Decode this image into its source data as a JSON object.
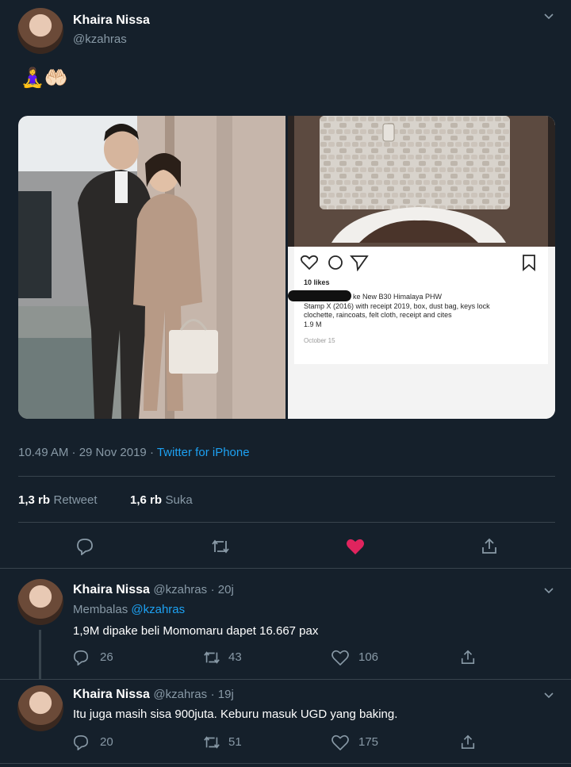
{
  "tweet": {
    "author_name": "Khaira Nissa",
    "author_handle": "@kzahras",
    "text": "🧘‍♀️🤲🏻",
    "timestamp": "10.49 AM · 29 Nov 2019 · ",
    "source": "Twitter for iPhone",
    "retweet_count": "1,3 rb",
    "retweet_label": "Retweet",
    "like_count": "1,6 rb",
    "like_label": "Suka",
    "embedded_image": {
      "likes": "10 likes",
      "caption_line1": "ke New B30 Himalaya PHW",
      "caption_line2": "Stamp X (2016) with receipt 2019, box, dust bag, keys lock",
      "caption_line3": "clochette, raincoats, felt cloth, receipt and cites",
      "caption_line4": "1.9 M",
      "date": "October 15"
    }
  },
  "replies": [
    {
      "author_name": "Khaira Nissa",
      "author_handle": "@kzahras",
      "time": "· 20j",
      "replying_label": "Membalas",
      "replying_to": "@kzahras",
      "text": "1,9M dipake beli Momomaru dapet 16.667 pax",
      "reply_count": "26",
      "retweet_count": "43",
      "like_count": "106"
    },
    {
      "author_name": "Khaira Nissa",
      "author_handle": "@kzahras",
      "time": "· 19j",
      "text": "Itu juga masih sisa 900juta. Keburu masuk UGD yang baking.",
      "reply_count": "20",
      "retweet_count": "51",
      "like_count": "175"
    }
  ],
  "colors": {
    "background": "#15202b",
    "accent": "#1da1f2",
    "like": "#e0245e",
    "muted": "#8899a6",
    "divider": "#38444d"
  }
}
